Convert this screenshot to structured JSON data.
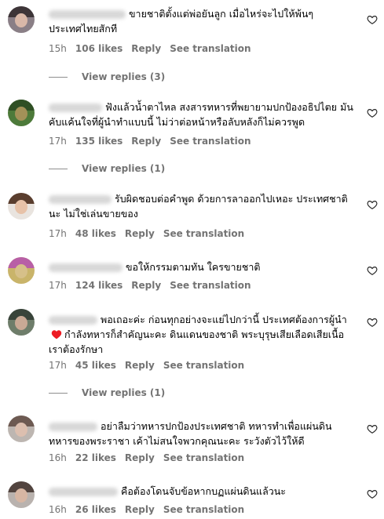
{
  "colors": {
    "meta_text": "#737373",
    "heart_red": "#ed1c24"
  },
  "comments": [
    {
      "text": "ขายชาติตั้งแต่พ่อยันลูก เมื่อไหร่จะไปให้พ้นๆ ประเทศไทยสักที",
      "time": "15h",
      "likes": "106 likes",
      "reply": "Reply",
      "translate": "See translation",
      "view_replies": "View replies (3)"
    },
    {
      "text": "ฟังแล้วน้ำตาไหล สงสารทหารที่พยายามปกป้องอธิปไตย มันคับแค้นใจที่ผู้นำทำแบบนี้ ไม่ว่าต่อหน้าหรือลับหลังก็ไม่ควรพูด",
      "time": "17h",
      "likes": "135 likes",
      "reply": "Reply",
      "translate": "See translation",
      "view_replies": "View replies (1)"
    },
    {
      "text": "รับผิดชอบต่อคำพูด ด้วยการลาออกไปเหอะ ประเทศชาตินะ ไม่ใช่เล่นขายของ",
      "time": "17h",
      "likes": "48 likes",
      "reply": "Reply",
      "translate": "See translation"
    },
    {
      "text": "ขอให้กรรมตามทัน ใครขายชาติ",
      "time": "17h",
      "likes": "124 likes",
      "reply": "Reply",
      "translate": "See translation"
    },
    {
      "text_before": "พอเถอะค่ะ ก่อนทุกอย่างจะแย่ไปกว่านี้ ประเทศต้องการผู้นำ",
      "text_after": "กำลังทหารก็สำคัญนะคะ ดินแดนของชาติ พระบุรุษเสียเลือดเสียเนื้อ เราต้องรักษา",
      "time": "17h",
      "likes": "45 likes",
      "reply": "Reply",
      "translate": "See translation",
      "view_replies": "View replies (1)"
    },
    {
      "text": "อย่าลืมว่าทหารปกป้องประเทศชาติ ทหารทำเพื่อแผ่นดิน ทหารของพระราชา เค้าไม่สนใจพวกคุณนะคะ ระวังตัวไว้ให้ดี",
      "time": "16h",
      "likes": "22 likes",
      "reply": "Reply",
      "translate": "See translation"
    },
    {
      "text": "คือต้องโดนจับข้อหากบฏแผ่นดินแล้วนะ",
      "time": "16h",
      "likes": "26 likes",
      "reply": "Reply",
      "translate": "See translation"
    }
  ]
}
